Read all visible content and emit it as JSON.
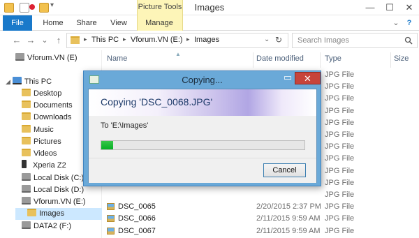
{
  "window": {
    "title": "Images",
    "minimize": "—",
    "maximize": "☐",
    "close": "✕"
  },
  "ribbon": {
    "tabs": [
      "File",
      "Home",
      "Share",
      "View",
      "Manage"
    ],
    "context_group": "Picture Tools",
    "help_glyph": "?"
  },
  "address": {
    "back": "←",
    "forward": "→",
    "dropdown": "⌄",
    "up": "↑",
    "path": [
      "This PC",
      "Vforum.VN (E:)",
      "Images"
    ],
    "separator": "▸",
    "refresh": "↻",
    "search_placeholder": "Search Images",
    "search_icon": "search-icon"
  },
  "nav": {
    "items": [
      {
        "label": "Vforum.VN (E)",
        "icon": "drive"
      },
      {
        "label": "This PC",
        "icon": "pc"
      },
      {
        "label": "Desktop",
        "icon": "folder"
      },
      {
        "label": "Documents",
        "icon": "folder"
      },
      {
        "label": "Downloads",
        "icon": "folder"
      },
      {
        "label": "Music",
        "icon": "folder"
      },
      {
        "label": "Pictures",
        "icon": "folder"
      },
      {
        "label": "Videos",
        "icon": "folder"
      },
      {
        "label": "Xperia Z2",
        "icon": "phone"
      },
      {
        "label": "Local Disk (C:)",
        "icon": "drive"
      },
      {
        "label": "Local Disk (D:)",
        "icon": "drive"
      },
      {
        "label": "Vforum.VN (E:)",
        "icon": "drive"
      },
      {
        "label": "Images",
        "icon": "folder",
        "selected": true
      },
      {
        "label": "DATA2 (F:)",
        "icon": "drive"
      }
    ]
  },
  "filelist": {
    "columns": [
      "Name",
      "Date modified",
      "Type",
      "Size"
    ],
    "rows": [
      {
        "name": "",
        "date": "",
        "type": "JPG File"
      },
      {
        "name": "",
        "date": "",
        "type": "JPG File"
      },
      {
        "name": "",
        "date": "",
        "type": "JPG File"
      },
      {
        "name": "",
        "date": "",
        "type": "JPG File"
      },
      {
        "name": "",
        "date": "",
        "type": "JPG File"
      },
      {
        "name": "",
        "date": "",
        "type": "JPG File"
      },
      {
        "name": "",
        "date": "",
        "type": "JPG File"
      },
      {
        "name": "",
        "date": "",
        "type": "JPG File"
      },
      {
        "name": "",
        "date": "",
        "type": "JPG File"
      },
      {
        "name": "",
        "date": "",
        "type": "JPG File"
      },
      {
        "name": "",
        "date": "",
        "type": "JPG File"
      },
      {
        "name": "DSC_0065",
        "date": "2/20/2015 2:37 PM",
        "type": "JPG File"
      },
      {
        "name": "DSC_0066",
        "date": "2/11/2015 9:59 AM",
        "type": "JPG File"
      },
      {
        "name": "DSC_0067",
        "date": "2/11/2015 9:59 AM",
        "type": "JPG File"
      }
    ]
  },
  "dialog": {
    "title": "Copying...",
    "heading": "Copying 'DSC_0068.JPG'",
    "destination": "To 'E:\\Images'",
    "progress": 0.06,
    "cancel_label": "Cancel",
    "minimize": "▭",
    "close": "✕"
  }
}
